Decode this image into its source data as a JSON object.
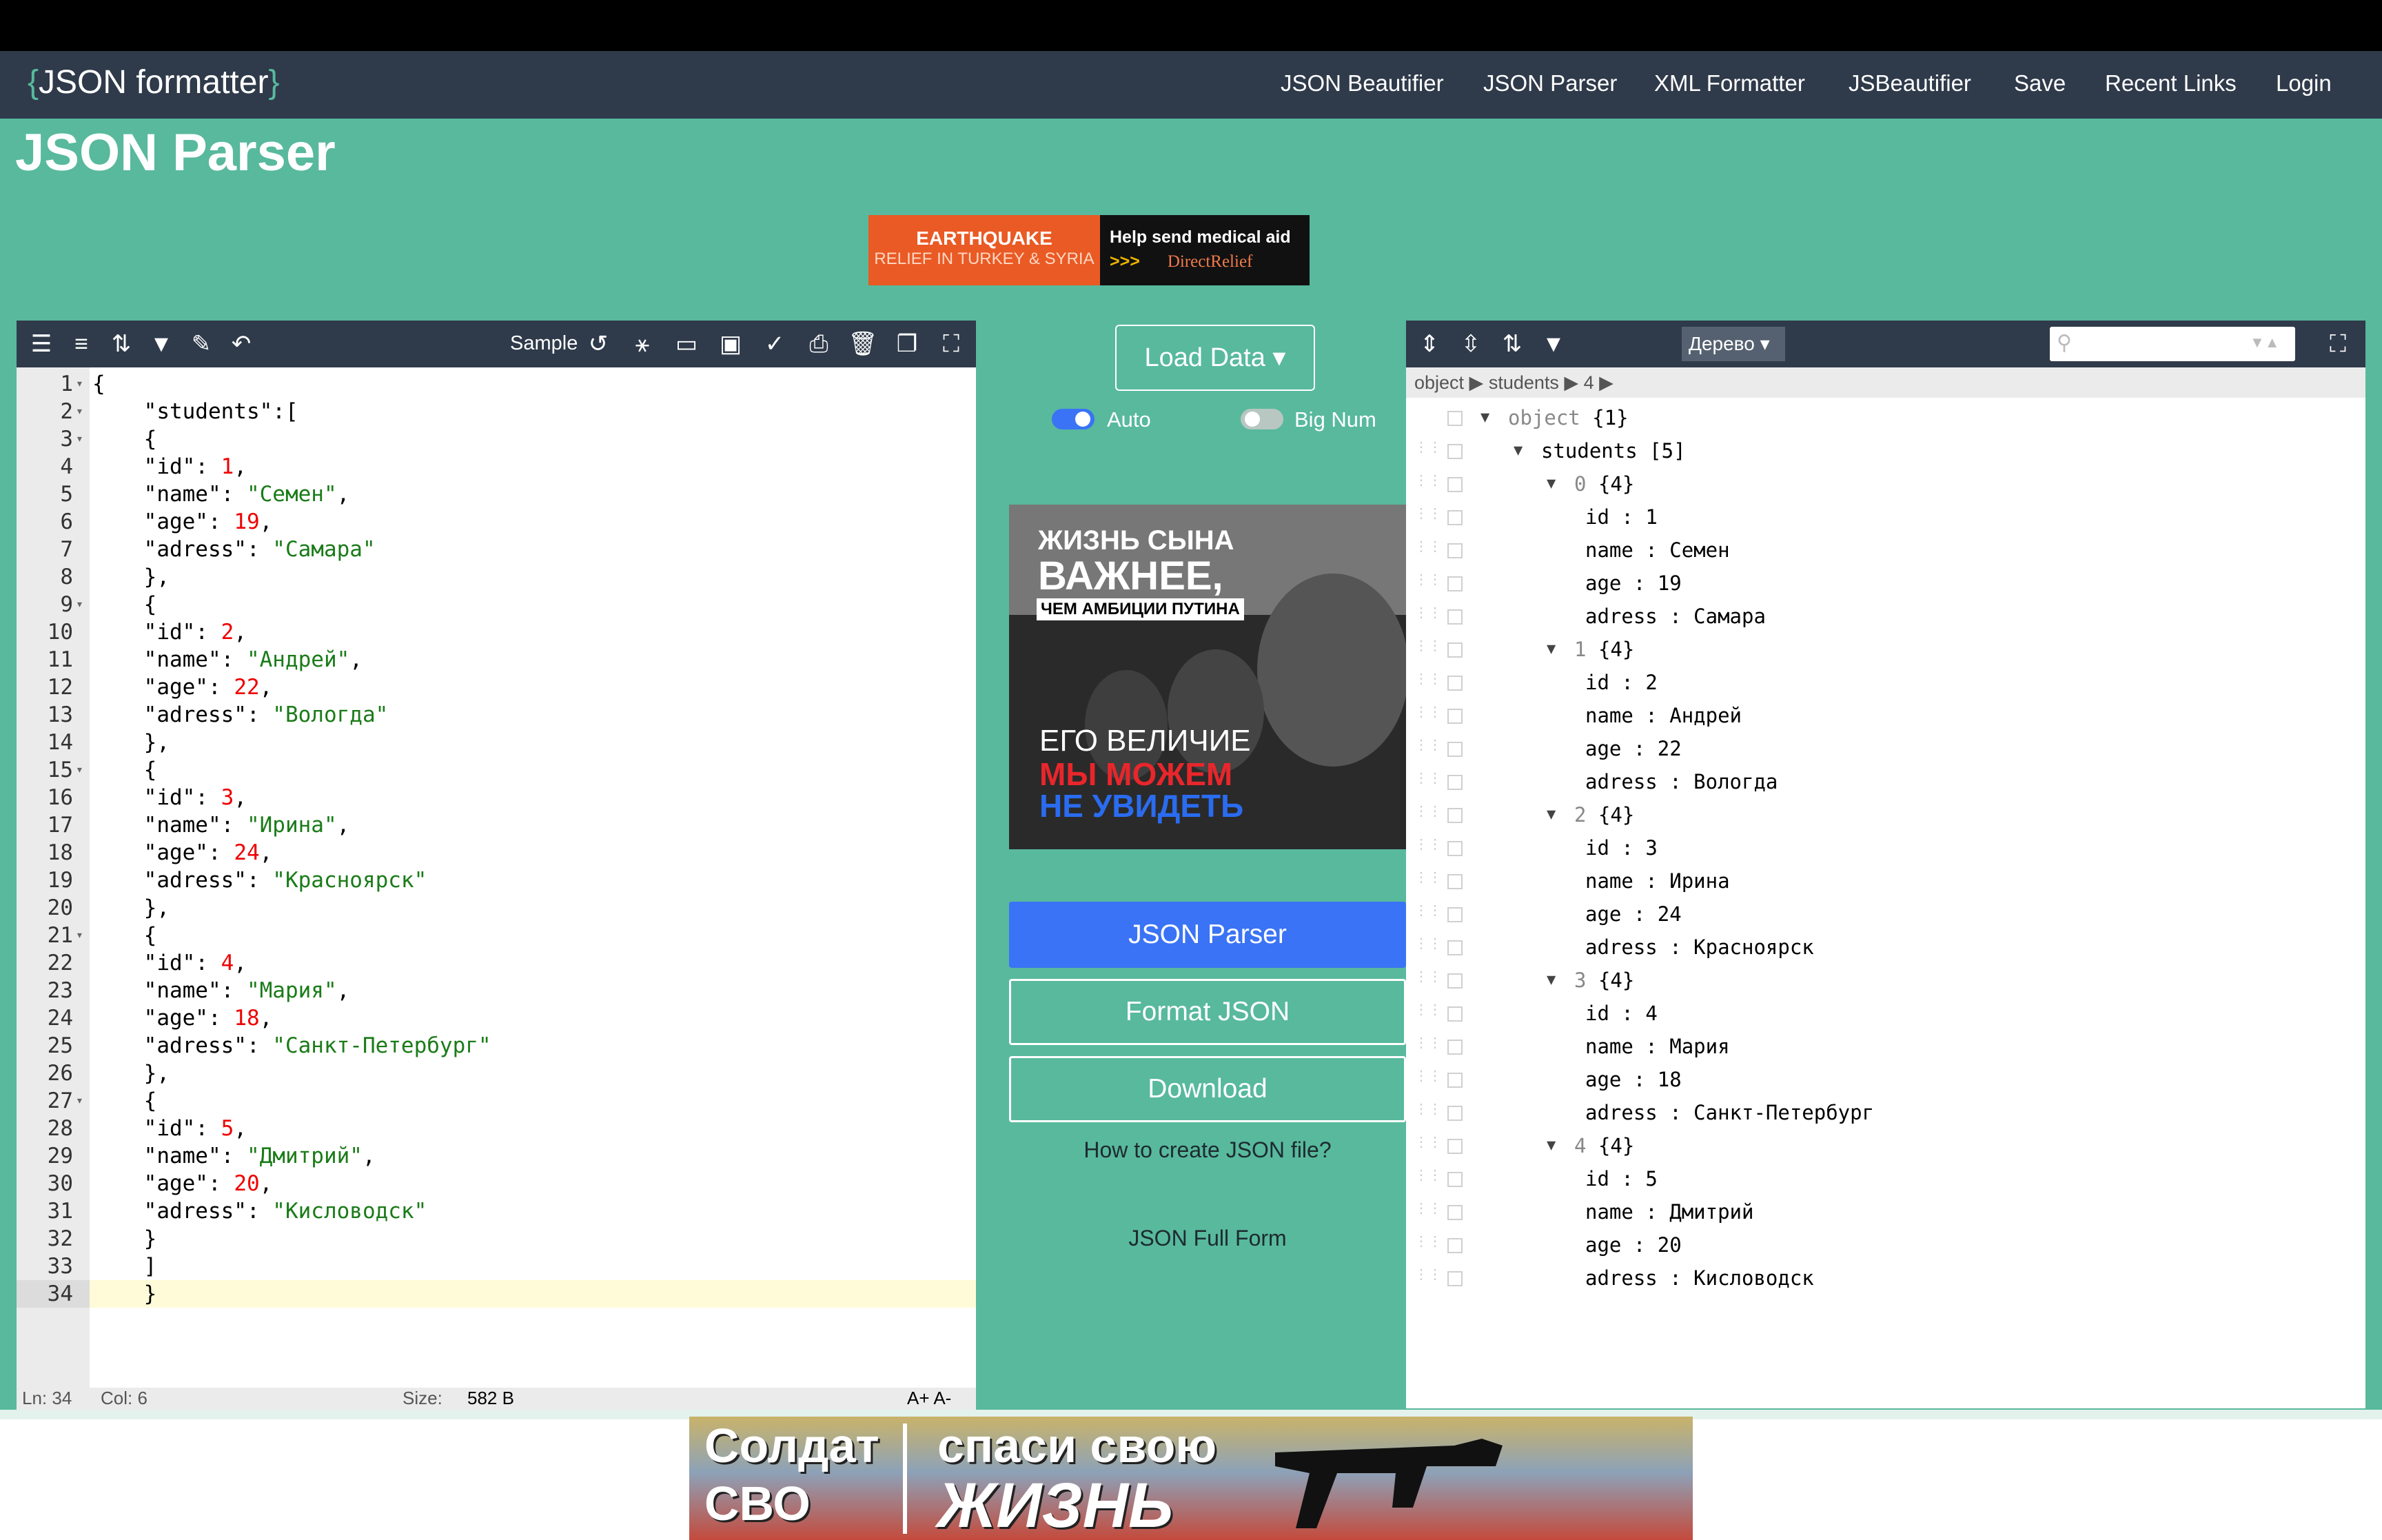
{
  "brand": {
    "open": "{",
    "text": "JSON formatter",
    "close": "}"
  },
  "nav": [
    "JSON Beautifier",
    "JSON Parser",
    "XML Formatter",
    "JSBeautifier",
    "Save",
    "Recent Links",
    "Login"
  ],
  "page_title": "JSON Parser",
  "ad_top": {
    "left1": "EARTHQUAKE",
    "left2": "RELIEF IN TURKEY & SYRIA",
    "right1": "Help send medical aid",
    "arrows": ">>>",
    "org": "DirectRelief"
  },
  "editor": {
    "sample_label": "Sample",
    "status": {
      "ln": "Ln: 34",
      "col": "Col: 6",
      "size_label": "Size:",
      "size_value": "582 B",
      "font_ctrl": "A+  A-"
    },
    "lines": [
      {
        "n": "1",
        "fold": true,
        "code": "{"
      },
      {
        "n": "2",
        "fold": true,
        "code": "    \"students\":["
      },
      {
        "n": "3",
        "fold": true,
        "code": "    {"
      },
      {
        "n": "4",
        "fold": false,
        "code": "    \"id\": 1,"
      },
      {
        "n": "5",
        "fold": false,
        "code": "    \"name\": \"Семен\","
      },
      {
        "n": "6",
        "fold": false,
        "code": "    \"age\": 19,"
      },
      {
        "n": "7",
        "fold": false,
        "code": "    \"adress\": \"Самара\""
      },
      {
        "n": "8",
        "fold": false,
        "code": "    },"
      },
      {
        "n": "9",
        "fold": true,
        "code": "    {"
      },
      {
        "n": "10",
        "fold": false,
        "code": "    \"id\": 2,"
      },
      {
        "n": "11",
        "fold": false,
        "code": "    \"name\": \"Андрей\","
      },
      {
        "n": "12",
        "fold": false,
        "code": "    \"age\": 22,"
      },
      {
        "n": "13",
        "fold": false,
        "code": "    \"adress\": \"Вологда\""
      },
      {
        "n": "14",
        "fold": false,
        "code": "    },"
      },
      {
        "n": "15",
        "fold": true,
        "code": "    {"
      },
      {
        "n": "16",
        "fold": false,
        "code": "    \"id\": 3,"
      },
      {
        "n": "17",
        "fold": false,
        "code": "    \"name\": \"Ирина\","
      },
      {
        "n": "18",
        "fold": false,
        "code": "    \"age\": 24,"
      },
      {
        "n": "19",
        "fold": false,
        "code": "    \"adress\": \"Красноярск\""
      },
      {
        "n": "20",
        "fold": false,
        "code": "    },"
      },
      {
        "n": "21",
        "fold": true,
        "code": "    {"
      },
      {
        "n": "22",
        "fold": false,
        "code": "    \"id\": 4,"
      },
      {
        "n": "23",
        "fold": false,
        "code": "    \"name\": \"Мария\","
      },
      {
        "n": "24",
        "fold": false,
        "code": "    \"age\": 18,"
      },
      {
        "n": "25",
        "fold": false,
        "code": "    \"adress\": \"Санкт-Петербург\""
      },
      {
        "n": "26",
        "fold": false,
        "code": "    },"
      },
      {
        "n": "27",
        "fold": true,
        "code": "    {"
      },
      {
        "n": "28",
        "fold": false,
        "code": "    \"id\": 5,"
      },
      {
        "n": "29",
        "fold": false,
        "code": "    \"name\": \"Дмитрий\","
      },
      {
        "n": "30",
        "fold": false,
        "code": "    \"age\": 20,"
      },
      {
        "n": "31",
        "fold": false,
        "code": "    \"adress\": \"Кисловодск\""
      },
      {
        "n": "32",
        "fold": false,
        "code": "    }"
      },
      {
        "n": "33",
        "fold": false,
        "code": "    ]"
      },
      {
        "n": "34",
        "fold": false,
        "code": "    }"
      }
    ]
  },
  "middle": {
    "load_data": "Load Data",
    "auto_label": "Auto",
    "bignum_label": "Big Num",
    "ad_mid": {
      "l1": "ЖИЗНЬ СЫНА",
      "l2": "ВАЖНЕЕ,",
      "l3": "ЧЕМ АМБИЦИИ ПУТИНА",
      "l4": "ЕГО ВЕЛИЧИЕ",
      "l5": "МЫ МОЖЕМ",
      "l6": "НЕ УВИДЕТЬ"
    },
    "parser_btn": "JSON Parser",
    "format_btn": "Format JSON",
    "download_btn": "Download",
    "link1": "How to create JSON file?",
    "link2": "JSON Full Form"
  },
  "tree": {
    "mode": "Дерево",
    "breadcrumb": "object ▶ students ▶ 4 ▶",
    "rows": [
      {
        "indent": 0,
        "toggle": true,
        "key": "object",
        "val": "{1}",
        "is_idx": false
      },
      {
        "indent": 1,
        "toggle": true,
        "key": "students",
        "val": "[5]",
        "is_idx": false
      },
      {
        "indent": 2,
        "toggle": true,
        "key": "0",
        "val": "{4}",
        "is_idx": true
      },
      {
        "indent": 3,
        "toggle": false,
        "key": "id",
        "sep": " : ",
        "val": "1"
      },
      {
        "indent": 3,
        "toggle": false,
        "key": "name",
        "sep": " : ",
        "val": "Семен"
      },
      {
        "indent": 3,
        "toggle": false,
        "key": "age",
        "sep": " : ",
        "val": "19"
      },
      {
        "indent": 3,
        "toggle": false,
        "key": "adress",
        "sep": " : ",
        "val": "Самара"
      },
      {
        "indent": 2,
        "toggle": true,
        "key": "1",
        "val": "{4}",
        "is_idx": true
      },
      {
        "indent": 3,
        "toggle": false,
        "key": "id",
        "sep": " : ",
        "val": "2"
      },
      {
        "indent": 3,
        "toggle": false,
        "key": "name",
        "sep": " : ",
        "val": "Андрей"
      },
      {
        "indent": 3,
        "toggle": false,
        "key": "age",
        "sep": " : ",
        "val": "22"
      },
      {
        "indent": 3,
        "toggle": false,
        "key": "adress",
        "sep": " : ",
        "val": "Вологда"
      },
      {
        "indent": 2,
        "toggle": true,
        "key": "2",
        "val": "{4}",
        "is_idx": true
      },
      {
        "indent": 3,
        "toggle": false,
        "key": "id",
        "sep": " : ",
        "val": "3"
      },
      {
        "indent": 3,
        "toggle": false,
        "key": "name",
        "sep": " : ",
        "val": "Ирина"
      },
      {
        "indent": 3,
        "toggle": false,
        "key": "age",
        "sep": " : ",
        "val": "24"
      },
      {
        "indent": 3,
        "toggle": false,
        "key": "adress",
        "sep": " : ",
        "val": "Красноярск"
      },
      {
        "indent": 2,
        "toggle": true,
        "key": "3",
        "val": "{4}",
        "is_idx": true
      },
      {
        "indent": 3,
        "toggle": false,
        "key": "id",
        "sep": " : ",
        "val": "4"
      },
      {
        "indent": 3,
        "toggle": false,
        "key": "name",
        "sep": " : ",
        "val": "Мария"
      },
      {
        "indent": 3,
        "toggle": false,
        "key": "age",
        "sep": " : ",
        "val": "18"
      },
      {
        "indent": 3,
        "toggle": false,
        "key": "adress",
        "sep": " : ",
        "val": "Санкт-Петербург"
      },
      {
        "indent": 2,
        "toggle": true,
        "key": "4",
        "val": "{4}",
        "is_idx": true
      },
      {
        "indent": 3,
        "toggle": false,
        "key": "id",
        "sep": " : ",
        "val": "5"
      },
      {
        "indent": 3,
        "toggle": false,
        "key": "name",
        "sep": " : ",
        "val": "Дмитрий"
      },
      {
        "indent": 3,
        "toggle": false,
        "key": "age",
        "sep": " : ",
        "val": "20"
      },
      {
        "indent": 3,
        "toggle": false,
        "key": "adress",
        "sep": " : ",
        "val": "Кисловодск"
      }
    ]
  },
  "ad_bottom": {
    "l1": "Солдат",
    "l2": "СВО",
    "r1": "спаси свою",
    "r2": "ЖИЗНЬ"
  },
  "colors": {
    "accent": "#58b99d",
    "navbar": "#2f3a4a",
    "primary_button": "#3a73f5"
  },
  "icons": [
    "indent-icon",
    "compact-icon",
    "sort-icon",
    "filter-icon",
    "wrench-icon",
    "undo-icon",
    "history-icon",
    "tree-icon",
    "folder-icon",
    "save-icon",
    "check-icon",
    "print-icon",
    "trash-icon",
    "copy-icon",
    "fullscreen-icon",
    "expand-all-icon",
    "collapse-all-icon",
    "search-icon"
  ]
}
